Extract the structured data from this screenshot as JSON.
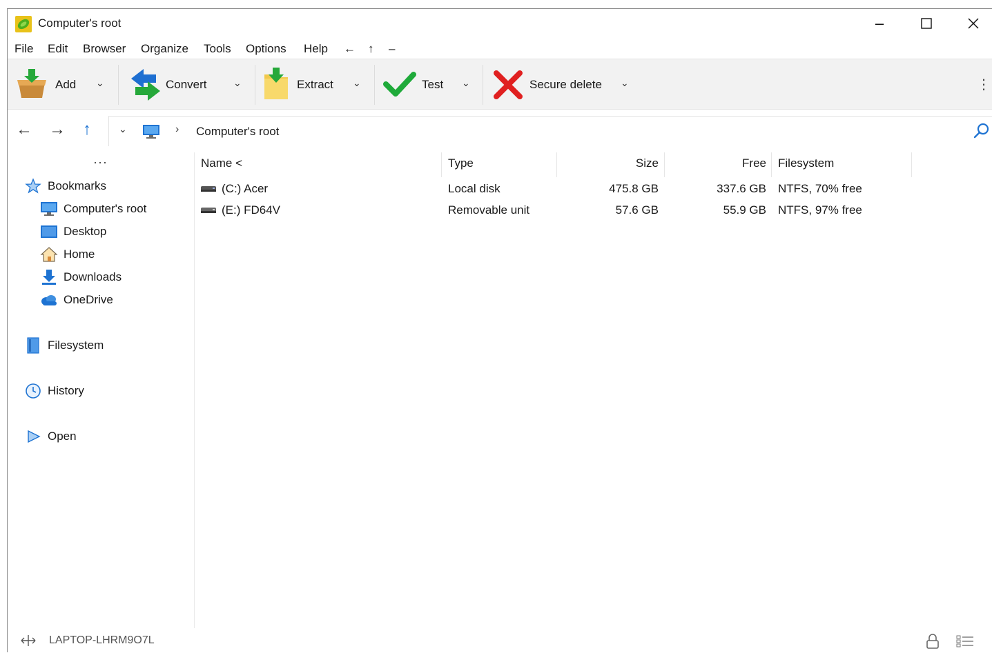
{
  "window": {
    "title": "Computer's root",
    "controls": {
      "minimize": "–",
      "maximize": "☐",
      "close": "✕"
    }
  },
  "menu": {
    "items": [
      "File",
      "Edit",
      "Browser",
      "Organize",
      "Tools",
      "Options",
      "Help"
    ],
    "nav_back": "←",
    "nav_up": "↑",
    "nav_more": "–"
  },
  "toolbar": {
    "add_label": "Add",
    "convert_label": "Convert",
    "extract_label": "Extract",
    "test_label": "Test",
    "secure_delete_label": "Secure delete",
    "chevron": "⌄",
    "more": "⋮"
  },
  "address": {
    "back": "←",
    "forward": "→",
    "up": "↑",
    "history": "⌄",
    "separator": "›",
    "path": "Computer's root"
  },
  "sidebar": {
    "dots": "···",
    "bookmarks_label": "Bookmarks",
    "bookmarks": [
      {
        "label": "Computer's root",
        "icon": "monitor-icon"
      },
      {
        "label": "Desktop",
        "icon": "desktop-icon"
      },
      {
        "label": "Home",
        "icon": "home-icon"
      },
      {
        "label": "Downloads",
        "icon": "download-icon"
      },
      {
        "label": "OneDrive",
        "icon": "cloud-icon"
      }
    ],
    "filesystem_label": "Filesystem",
    "history_label": "History",
    "open_label": "Open"
  },
  "filelist": {
    "columns": {
      "name": "Name <",
      "type": "Type",
      "size": "Size",
      "free": "Free",
      "filesystem": "Filesystem"
    },
    "rows": [
      {
        "name": "(C:) Acer",
        "type": "Local disk",
        "size": "475.8 GB",
        "free": "337.6 GB",
        "filesystem": "NTFS, 70% free"
      },
      {
        "name": "(E:) FD64V",
        "type": "Removable unit",
        "size": "57.6 GB",
        "free": "55.9 GB",
        "filesystem": "NTFS, 97% free"
      }
    ]
  },
  "status": {
    "hostname": "LAPTOP-LHRM9O7L",
    "more": "⋮"
  },
  "colors": {
    "accent_blue": "#1e73d2",
    "toolbar_bg": "#f2f2f2",
    "test_green": "#1faa3a",
    "delete_red": "#e02020"
  }
}
